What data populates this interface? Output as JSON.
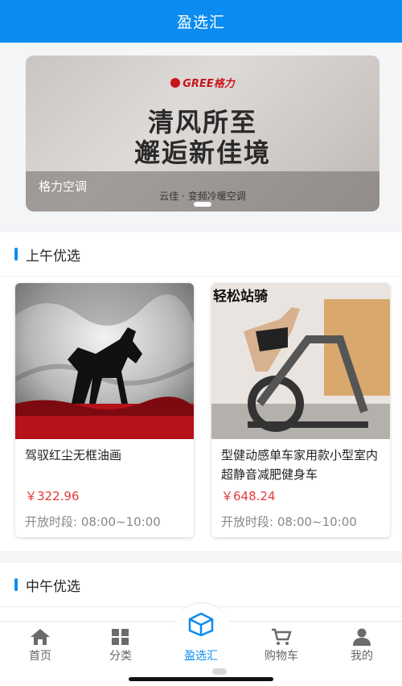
{
  "header": {
    "title": "盈选汇"
  },
  "banner": {
    "brand": "GREE格力",
    "headline_line1": "清风所至",
    "headline_line2": "邂逅新佳境",
    "caption_title": "格力空调",
    "caption_subtitle": "云佳 · 变频冷暖空调"
  },
  "sections": [
    {
      "title": "上午优选",
      "products": [
        {
          "title": "驾驭红尘无框油画",
          "price": "￥322.96",
          "hours": "开放时段: 08:00~10:00"
        },
        {
          "title": "型健动感单车家用款小型室内超静音减肥健身车",
          "price": "￥648.24",
          "hours": "开放时段: 08:00~10:00",
          "image_text": "轻松站骑"
        }
      ]
    },
    {
      "title": "中午优选"
    }
  ],
  "tabbar": {
    "items": [
      {
        "label": "首页",
        "icon": "home-icon"
      },
      {
        "label": "分类",
        "icon": "grid-icon"
      },
      {
        "label": "盈选汇",
        "icon": "box-icon",
        "active": true
      },
      {
        "label": "购物车",
        "icon": "cart-icon"
      },
      {
        "label": "我的",
        "icon": "user-icon"
      }
    ]
  },
  "colors": {
    "accent": "#0b8cf0",
    "price": "#e4393c"
  }
}
